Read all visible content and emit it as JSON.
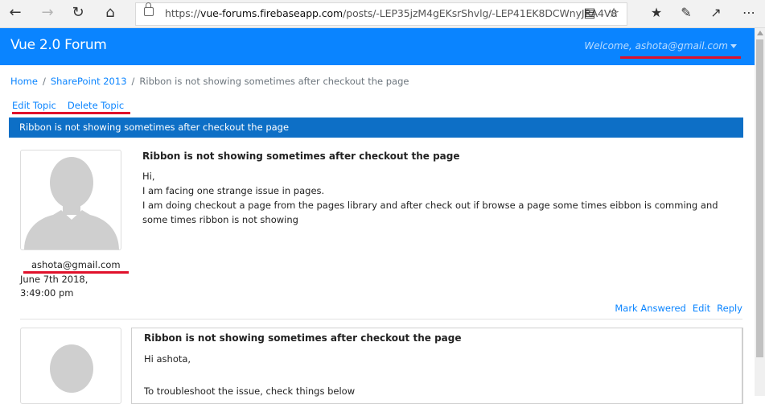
{
  "browser": {
    "url_prefix": "https://",
    "url_host": "vue-forums.firebaseapp.com",
    "url_path": "/posts/-LEP35jzM4gEKsrShvlg/-LEP41EK8DCWnyJRA4V8"
  },
  "navbar": {
    "brand": "Vue 2.0 Forum",
    "welcome": "Welcome, ashota@gmail.com"
  },
  "breadcrumb": {
    "home": "Home",
    "category": "SharePoint 2013",
    "current": "Ribbon is not showing sometimes after checkout the page"
  },
  "topic_actions": {
    "edit": "Edit Topic",
    "delete": "Delete Topic"
  },
  "topic_title": "Ribbon is not showing sometimes after checkout the page",
  "post": {
    "title": "Ribbon is not showing sometimes after checkout the page",
    "author": "ashota@gmail.com",
    "date": "June 7th 2018, 3:49:00 pm",
    "body": [
      "Hi,",
      "I am facing one strange issue in pages.",
      "I am doing checkout a page from the pages library and after check out if browse a page some times eibbon is comming and some times ribbon is not showing"
    ],
    "actions": {
      "mark_answered": "Mark Answered",
      "edit": "Edit",
      "reply": "Reply"
    }
  },
  "reply": {
    "title": "Ribbon is not showing sometimes after checkout the page",
    "body": [
      "Hi ashota,",
      "",
      "To troubleshoot the issue, check things below"
    ]
  }
}
